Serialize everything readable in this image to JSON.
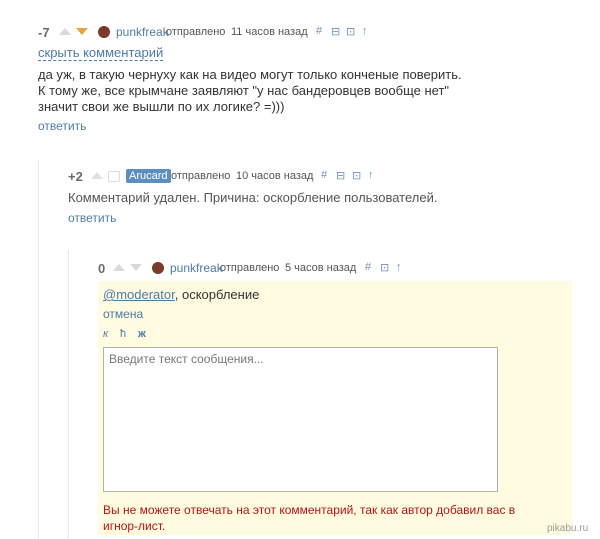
{
  "c1": {
    "rating": "-7",
    "author": "punkfreak",
    "sent": "отправлено",
    "time": "11 часов назад",
    "icons": [
      "hash-icon",
      "minimize-icon",
      "save-icon",
      "arrow-up-icon"
    ],
    "hide_label": "скрыть комментарий",
    "text": "да уж, в такую чернуху как на видео могут только конченые поверить.\nК тому же, все крымчане заявляют \"у нас бандеровцев вообще нет\"\nзначит свои же вышли по их логике? =)))",
    "reply_label": "ответить"
  },
  "c2": {
    "rating": "+2",
    "author": "Arucard",
    "sent": "отправлено",
    "time": "10 часов назад",
    "text": "Комментарий удален. Причина: оскорбление пользователей.",
    "reply_label": "ответить"
  },
  "c3": {
    "rating": "0",
    "author": "punkfreak",
    "sent": "отправлено",
    "time": "5 часов назад"
  },
  "reply": {
    "mention": "@moderator",
    "mention_suffix": ", оскорбление",
    "cancel_label": "отмена",
    "format": {
      "italic": "к",
      "link": "ħ",
      "bold": "ж"
    },
    "placeholder": "Введите текст сообщения...",
    "error": "Вы не можете отвечать на этот комментарий, так как автор добавил вас в игнор-лист."
  },
  "watermark": "pikabu.ru",
  "colors": {
    "link": "#4e7ba5",
    "reply_bg": "#fefbe1",
    "error": "#b31515",
    "downvote_active": "#e8a33c"
  }
}
